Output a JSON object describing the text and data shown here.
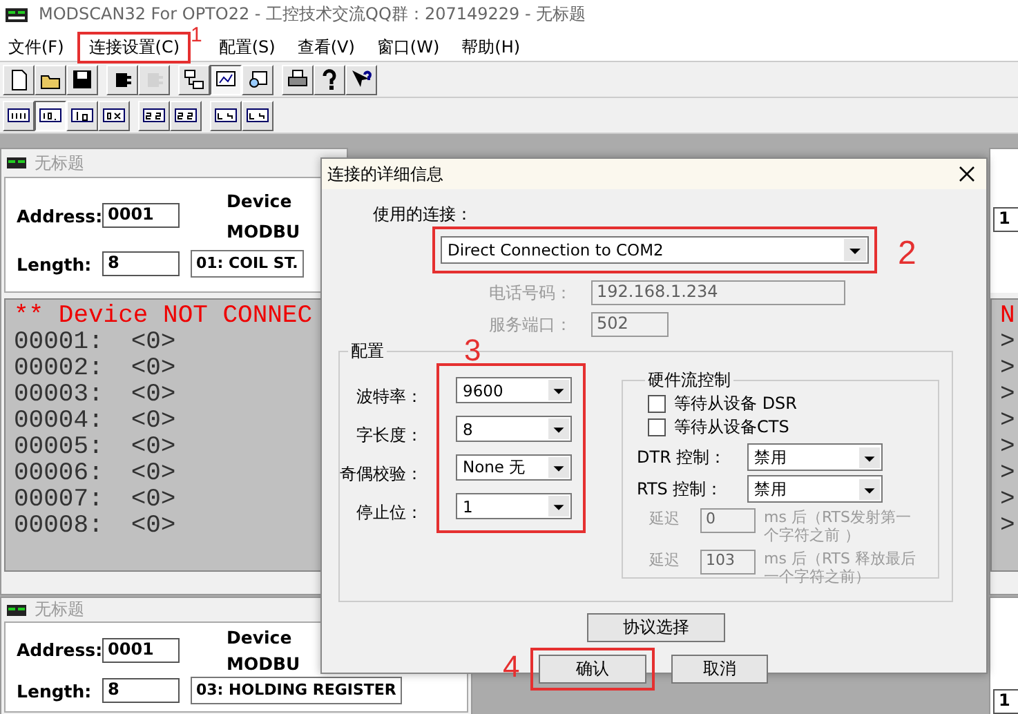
{
  "window": {
    "title": "MODSCAN32 For OPTO22 - 工控技术交流QQ群：207149229 - 无标题"
  },
  "menu": [
    {
      "label": "文件(F)",
      "highlighted": false
    },
    {
      "label": "连接设置(C)",
      "highlighted": true,
      "annotation": "1"
    },
    {
      "label": "配置(S)",
      "highlighted": false
    },
    {
      "label": "查看(V)",
      "highlighted": false
    },
    {
      "label": "窗口(W)",
      "highlighted": false
    },
    {
      "label": "帮助(H)",
      "highlighted": false
    }
  ],
  "toolbar": [
    [
      [
        {
          "pressed": false,
          "disabled": false
        },
        {
          "pressed": false,
          "disabled": false
        },
        {
          "pressed": false,
          "disabled": false
        }
      ],
      [
        {
          "pressed": false,
          "disabled": false
        },
        {
          "pressed": false,
          "disabled": true
        }
      ],
      [
        {
          "pressed": false,
          "disabled": false
        },
        {
          "pressed": true,
          "disabled": false
        },
        {
          "pressed": false,
          "disabled": false
        }
      ],
      [
        {
          "pressed": false,
          "disabled": false
        },
        {
          "pressed": false,
          "disabled": false
        },
        {
          "pressed": false,
          "disabled": false
        }
      ]
    ],
    [
      [
        {
          "pressed": false,
          "disabled": false
        },
        {
          "pressed": true,
          "disabled": false
        },
        {
          "pressed": false,
          "disabled": false
        },
        {
          "pressed": false,
          "disabled": false
        }
      ],
      [
        {
          "pressed": false,
          "disabled": false
        },
        {
          "pressed": false,
          "disabled": false
        }
      ],
      [
        {
          "pressed": false,
          "disabled": false
        },
        {
          "pressed": false,
          "disabled": false
        }
      ]
    ]
  ],
  "mdi_windows": [
    {
      "title": "无标题",
      "address_label": "Address:",
      "address": "0001",
      "length_label": "Length:",
      "length": "8",
      "device_label": "Device",
      "device_value": "MODBU",
      "function": "01: COIL ST.",
      "status": "** Device NOT CONNEC",
      "rows": [
        {
          "address": "00001:",
          "value": "<0>"
        },
        {
          "address": "00002:",
          "value": "<0>"
        },
        {
          "address": "00003:",
          "value": "<0>"
        },
        {
          "address": "00004:",
          "value": "<0>"
        },
        {
          "address": "00005:",
          "value": "<0>"
        },
        {
          "address": "00006:",
          "value": "<0>"
        },
        {
          "address": "00007:",
          "value": "<0>"
        },
        {
          "address": "00008:",
          "value": "<0>"
        }
      ]
    },
    {
      "title": "无标题",
      "address_label": "Address:",
      "address": "0001",
      "length_label": "Length:",
      "length": "8",
      "device_label": "Device",
      "device_value": "MODBU",
      "function": "03: HOLDING REGISTER"
    }
  ],
  "right_windows": [
    {
      "field": "1",
      "status": "N",
      "row_ends": [
        ">",
        ">",
        ">",
        ">",
        ">",
        ">",
        ">",
        ">"
      ]
    },
    {
      "field": "1"
    }
  ],
  "dialog": {
    "title": "连接的详细信息",
    "connection_label": "使用的连接：",
    "connection": "Direct Connection to COM2",
    "connection_annotation": "2",
    "phone_label": "电话号码：",
    "phone": "192.168.1.234",
    "port_label": "服务端口：",
    "port": "502",
    "address_disabled": true,
    "config": {
      "title": "配置",
      "annotation": "3",
      "fields": [
        {
          "label": "波特率：",
          "value": "9600"
        },
        {
          "label": "字长度：",
          "value": "8"
        },
        {
          "label": "奇偶校验：",
          "value": "None 无"
        },
        {
          "label": "停止位：",
          "value": "1"
        }
      ]
    },
    "flow": {
      "title": "硬件流控制",
      "checkboxes": [
        {
          "label": "等待从设备 DSR",
          "checked": false
        },
        {
          "label": "等待从设备CTS",
          "checked": false
        }
      ],
      "selects": [
        {
          "label": "DTR 控制：",
          "value": "禁用"
        },
        {
          "label": "RTS 控制：",
          "value": "禁用"
        }
      ],
      "delays": [
        {
          "label": "延迟",
          "value": "0",
          "note": "ms 后（RTS发射第一个字符之前 ）",
          "disabled": true
        },
        {
          "label": "延迟",
          "value": "103",
          "note": "ms 后（RTS 释放最后一个字符之前）",
          "disabled": true
        }
      ]
    },
    "protocol_button": "协议选择",
    "buttons": [
      {
        "label": "确认",
        "kind": "ok",
        "annotation": "4"
      },
      {
        "label": "取消",
        "kind": "cancel"
      }
    ]
  }
}
